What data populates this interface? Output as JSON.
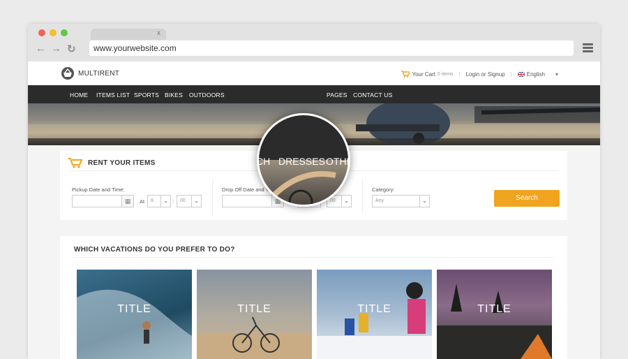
{
  "browser": {
    "tab_close": "x",
    "url": "www.yourwebsite.com",
    "colors": {
      "close": "#f26152",
      "minimize": "#f6be29",
      "maximize": "#5fc84a"
    }
  },
  "header": {
    "logo": "MULTIRENT",
    "cart_label": "Your Cart",
    "cart_count": "0 items",
    "login": "Login or Signup",
    "language": "English"
  },
  "nav": [
    "HOME",
    "ITEMS LIST",
    "SPORTS",
    "BIKES",
    "OUTDOORS",
    "PAGES",
    "CONTACT US"
  ],
  "magnifier": [
    "CH",
    "DRESSES",
    "OTHE"
  ],
  "rent": {
    "title": "RENT YOUR ITEMS",
    "pickup_label": "Pickup Date and Time:",
    "dropoff_label": "Drop Off Date and Time:",
    "at": "At",
    "hour": "8",
    "minute": "00",
    "sep": ":",
    "category_label": "Category:",
    "category_value": "Any",
    "search": "Search"
  },
  "vacations": {
    "title": "WHICH VACATIONS DO YOU PREFER TO DO?",
    "cards": [
      {
        "label": "TITLE"
      },
      {
        "label": "TITLE"
      },
      {
        "label": "TITLE"
      },
      {
        "label": "TITLE"
      }
    ]
  },
  "accent": "#f0a41f"
}
